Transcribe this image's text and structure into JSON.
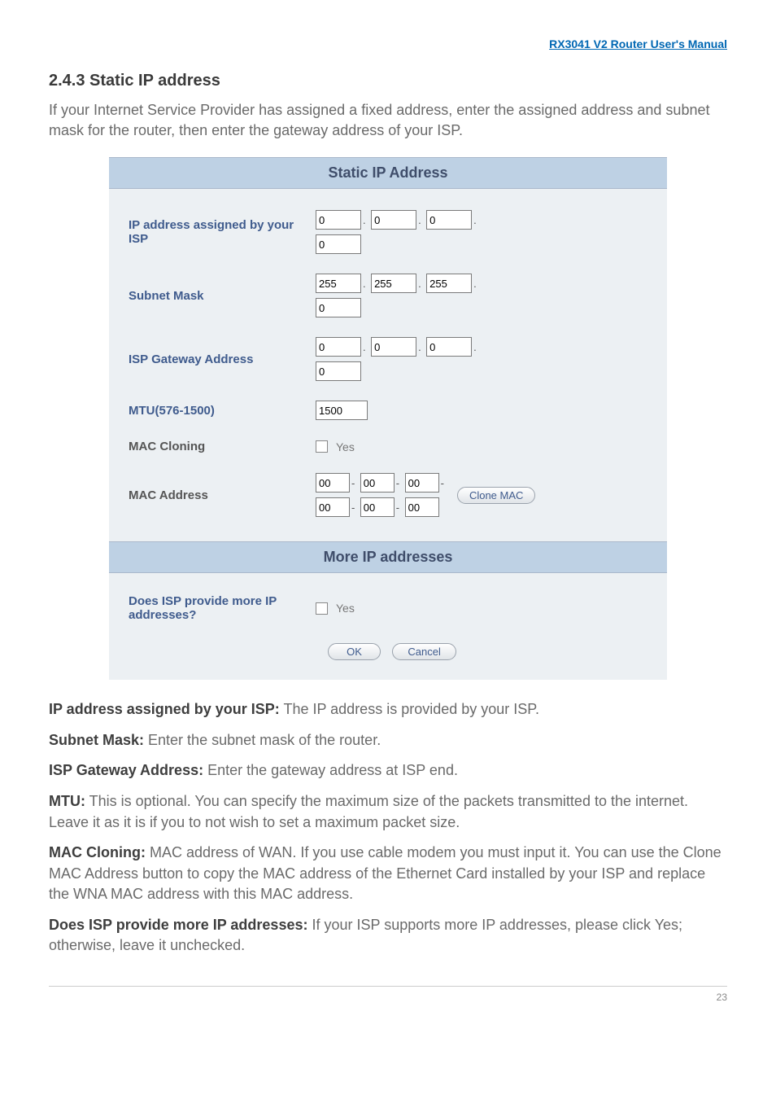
{
  "header_link": "RX3041 V2 Router User's Manual",
  "heading": "2.4.3 Static IP address",
  "intro": "If your Internet Service Provider has assigned a fixed address, enter the assigned address and subnet mask for the router, then enter the gateway address of your ISP.",
  "panel1": {
    "title": "Static IP Address",
    "ip_assigned": {
      "label": "IP address assigned by your ISP",
      "oct": [
        "0",
        "0",
        "0",
        "0"
      ]
    },
    "subnet": {
      "label": "Subnet Mask",
      "oct": [
        "255",
        "255",
        "255",
        "0"
      ]
    },
    "gateway": {
      "label": "ISP Gateway Address",
      "oct": [
        "0",
        "0",
        "0",
        "0"
      ]
    },
    "mtu": {
      "label": "MTU(576-1500)",
      "value": "1500"
    },
    "maccloning": {
      "label": "MAC Cloning",
      "text": "Yes"
    },
    "macaddr": {
      "label": "MAC Address",
      "oct": [
        "00",
        "00",
        "00",
        "00",
        "00",
        "00"
      ],
      "clone": "Clone MAC"
    }
  },
  "panel2": {
    "title": "More IP addresses",
    "moreip": {
      "label": "Does ISP provide more IP addresses?",
      "text": "Yes"
    }
  },
  "ok": "OK",
  "cancel": "Cancel",
  "para": [
    {
      "b": "IP address assigned by your ISP:",
      "t": " The IP address is provided by your ISP."
    },
    {
      "b": "Subnet Mask:",
      "t": " Enter the subnet mask of the router."
    },
    {
      "b": "ISP Gateway Address:",
      "t": " Enter the gateway address at ISP end."
    },
    {
      "b": "MTU:",
      "t": " This is optional. You can specify the maximum size of the packets transmitted to the internet. Leave it as it is if you to not wish to set a maximum packet size."
    },
    {
      "b": "MAC Cloning:",
      "t": " MAC address of WAN. If you use cable modem you must input it. You can use the Clone MAC Address button to copy the MAC address of the Ethernet Card installed by your ISP and replace the WNA MAC address with this MAC address."
    },
    {
      "b": "Does ISP provide more IP addresses:",
      "t": " If your ISP supports more IP addresses, please click Yes; otherwise, leave it unchecked."
    }
  ],
  "pagenum": "23"
}
